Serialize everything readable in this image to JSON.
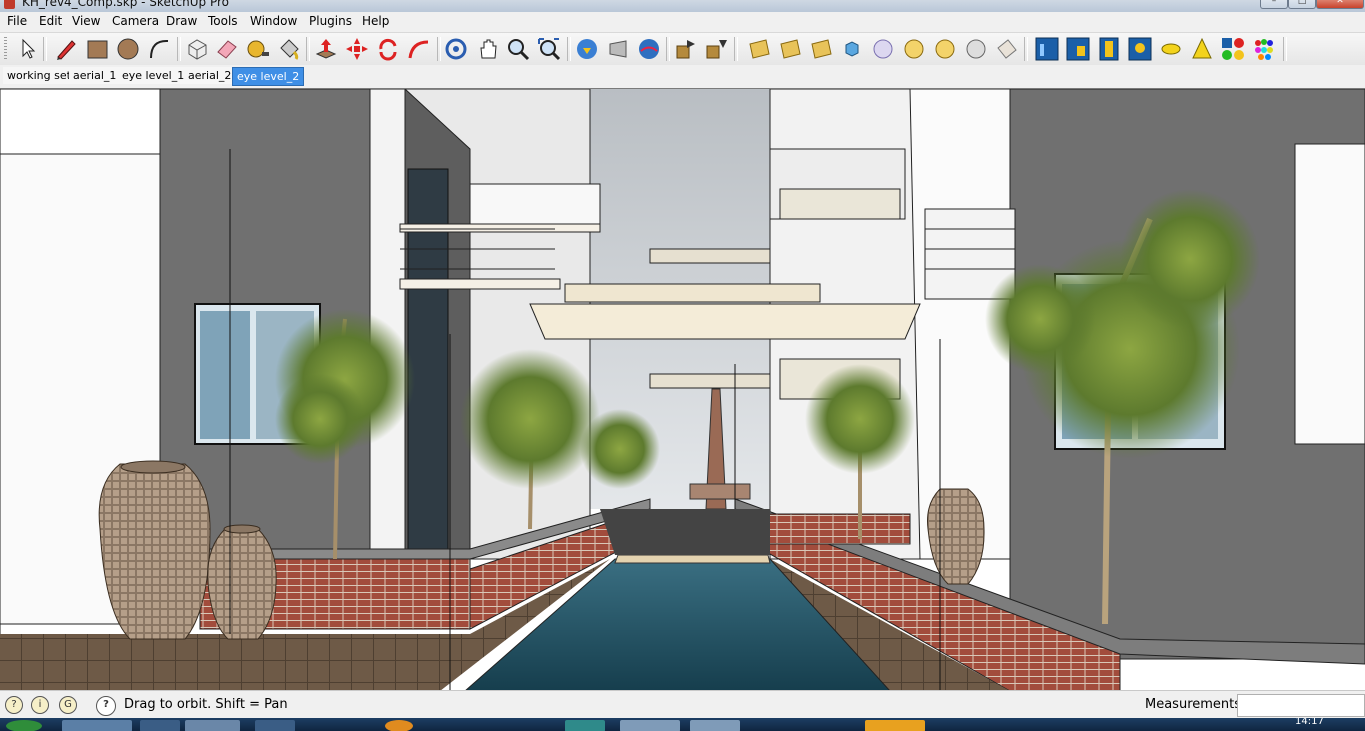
{
  "window": {
    "title": "KH_rev4_Comp.skp - SketchUp Pro"
  },
  "menu": {
    "items": [
      "File",
      "Edit",
      "View",
      "Camera",
      "Draw",
      "Tools",
      "Window",
      "Plugins",
      "Help"
    ]
  },
  "toolbar": {
    "icons": [
      "select-icon",
      "pencil-icon",
      "rectangle-icon",
      "circle-icon",
      "arc-icon",
      "make-component-icon",
      "eraser-icon",
      "tape-measure-icon",
      "paint-bucket-icon",
      "push-pull-icon",
      "move-icon",
      "rotate-icon",
      "follow-me-icon",
      "orbit-icon",
      "pan-icon",
      "zoom-icon",
      "zoom-extents-icon",
      "get-models-icon",
      "share-model-icon",
      "google-earth-icon",
      "import-icon",
      "export-icon",
      "plugin-1-icon",
      "plugin-2-icon",
      "plugin-3-icon",
      "plugin-4-icon",
      "plugin-5-icon",
      "plugin-6-icon",
      "plugin-7-icon",
      "plugin-8-icon",
      "plugin-9-icon",
      "render-settings-icon",
      "render-icon",
      "animation-icon",
      "environment-icon",
      "omni-light-icon",
      "spot-light-icon",
      "material-editor-icon",
      "color-palette-icon"
    ]
  },
  "scene_tabs": [
    {
      "label": "working set",
      "active": false
    },
    {
      "label": "aerial_1",
      "active": false
    },
    {
      "label": "eye level_1",
      "active": false
    },
    {
      "label": "aerial_2",
      "active": false
    },
    {
      "label": "eye level_2",
      "active": true
    }
  ],
  "status": {
    "hint": "Drag to orbit.  Shift = Pan",
    "measurements_label": "Measurements",
    "measurements_value": ""
  },
  "taskbar": {
    "clock": "14:17"
  },
  "colors": {
    "accent_tab": "#3f8fe6",
    "water": "#1f4f60",
    "brick": "#9a4a3a",
    "wall": "#6f6f6f"
  }
}
